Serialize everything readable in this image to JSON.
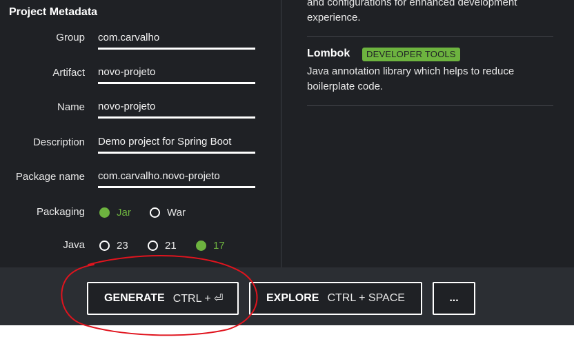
{
  "metadata": {
    "title": "Project Metadata",
    "fields": [
      {
        "label": "Group",
        "value": "com.carvalho"
      },
      {
        "label": "Artifact",
        "value": "novo-projeto"
      },
      {
        "label": "Name",
        "value": "novo-projeto"
      },
      {
        "label": "Description",
        "value": "Demo project for Spring Boot"
      },
      {
        "label": "Package name",
        "value": "com.carvalho.novo-projeto"
      }
    ],
    "packaging": {
      "label": "Packaging",
      "options": [
        {
          "label": "Jar",
          "selected": true
        },
        {
          "label": "War",
          "selected": false
        }
      ]
    },
    "java": {
      "label": "Java",
      "options": [
        {
          "label": "23",
          "selected": false
        },
        {
          "label": "21",
          "selected": false
        },
        {
          "label": "17",
          "selected": true
        }
      ]
    }
  },
  "dependencies": {
    "prev_desc_line1": "and configurations for enhanced development",
    "prev_desc_line2": "experience.",
    "items": [
      {
        "name": "Lombok",
        "badge": "DEVELOPER TOOLS",
        "desc_line1": "Java annotation library which helps to reduce",
        "desc_line2": "boilerplate code."
      }
    ]
  },
  "footer": {
    "generate": {
      "label": "GENERATE",
      "shortcut": "CTRL + ⏎"
    },
    "explore": {
      "label": "EXPLORE",
      "shortcut": "CTRL + SPACE"
    },
    "more": {
      "label": "..."
    }
  },
  "colors": {
    "accent": "#6db33f",
    "panel": "#1f2125",
    "footer": "#2b2e33",
    "annotation": "#e0141e"
  }
}
